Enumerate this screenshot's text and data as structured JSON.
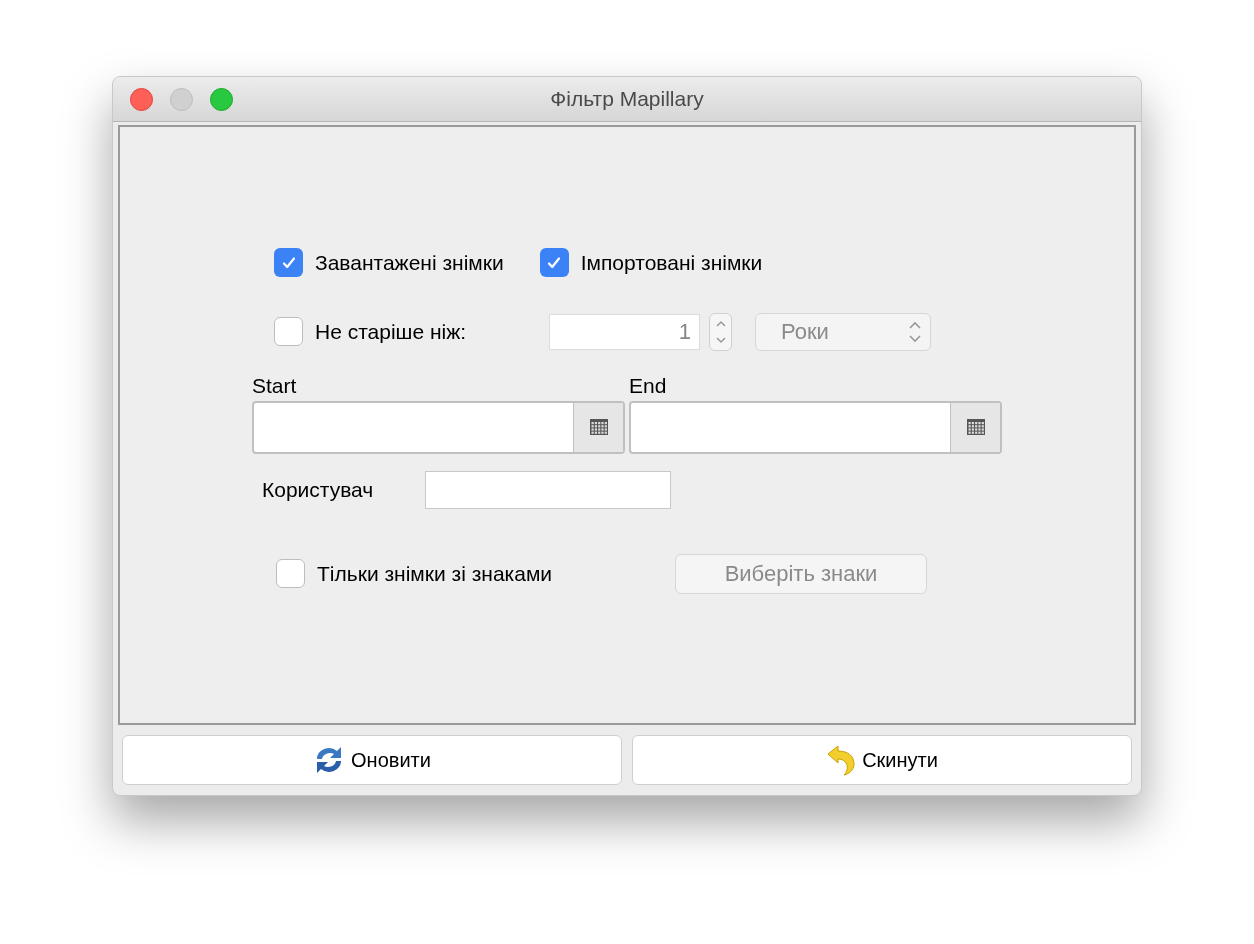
{
  "window": {
    "title": "Фільтр Mapillary"
  },
  "image_types": [
    {
      "label": "Завантажені знімки",
      "checked": true
    },
    {
      "label": "Імпортовані знімки",
      "checked": true
    }
  ],
  "age_filter": {
    "label": "Не старіше ніж:",
    "checked": false,
    "value": "1",
    "unit": "Роки"
  },
  "date_range": [
    {
      "label": "Start"
    },
    {
      "label": "End"
    }
  ],
  "user": {
    "label": "Користувач"
  },
  "signs_filter": {
    "label": "Тільки знімки зі знаками",
    "checked": false,
    "button": "Виберіть знаки"
  },
  "buttons": [
    {
      "label": "Оновити",
      "kind": "refresh"
    },
    {
      "label": "Скинути",
      "kind": "reset"
    }
  ]
}
